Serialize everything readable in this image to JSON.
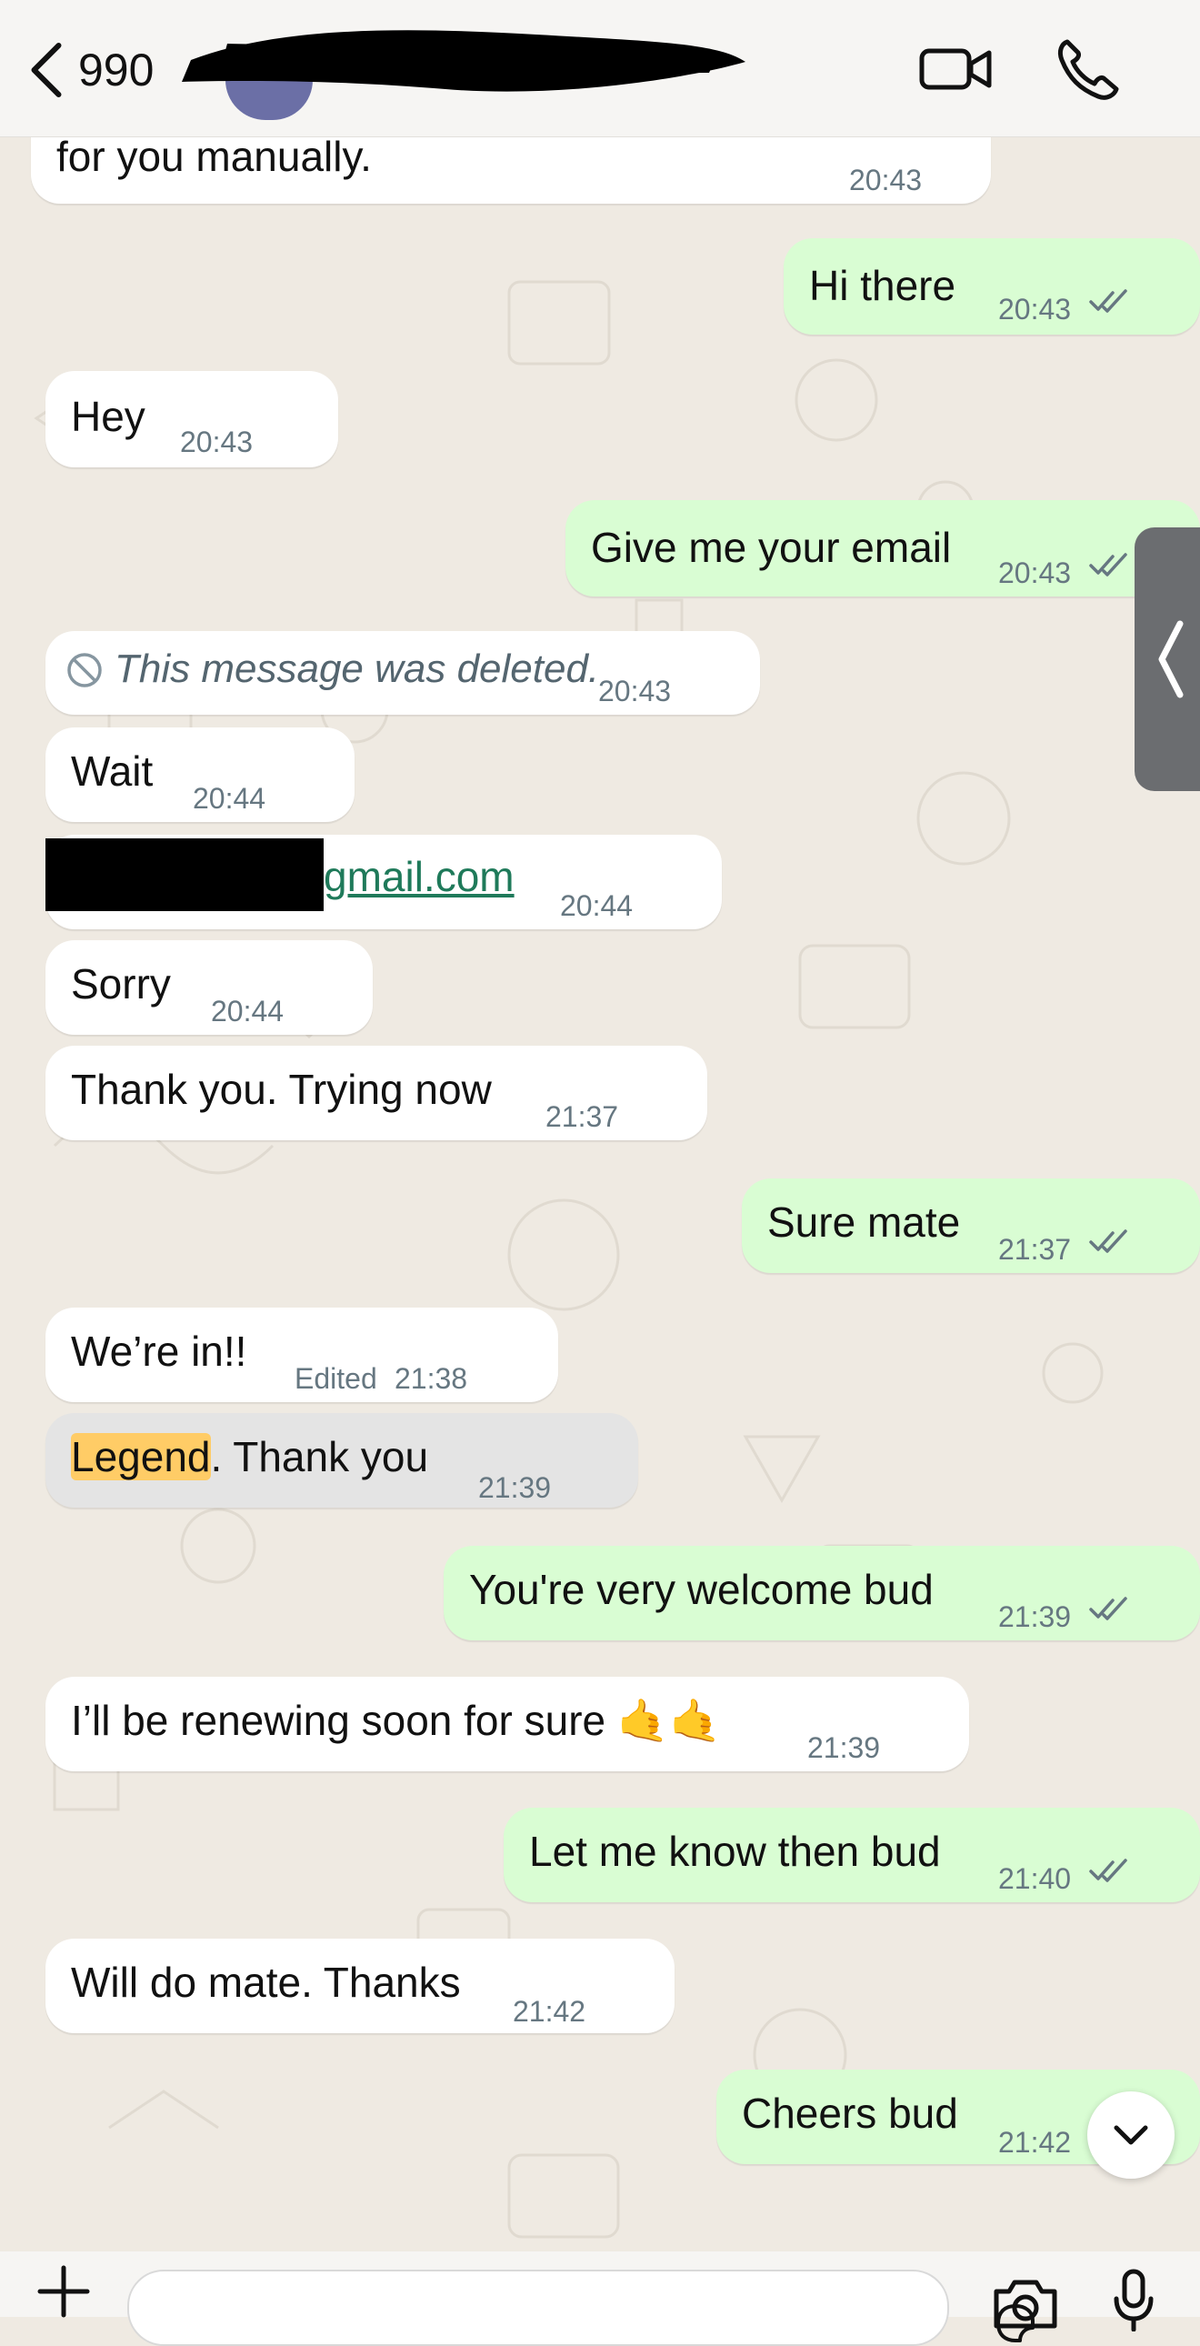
{
  "header": {
    "contact_name_visible": "990",
    "icons": {
      "back": "chevron-left-icon",
      "video": "video-camera-icon",
      "call": "phone-icon"
    }
  },
  "colors": {
    "chat_background": "#efeae2",
    "incoming_bubble": "#ffffff",
    "outgoing_bubble": "#d9fdd3",
    "timestamp": "#667781",
    "read_ticks": "#53bdeb",
    "link": "#1f7a5a",
    "highlight": "#ffcc66"
  },
  "messages": [
    {
      "direction": "in",
      "text": "for you manually.",
      "time": "20:43"
    },
    {
      "direction": "out",
      "text": "Hi there",
      "time": "20:43",
      "status": "read"
    },
    {
      "direction": "in",
      "text": "Hey",
      "time": "20:43"
    },
    {
      "direction": "out",
      "text": "Give me your email",
      "time": "20:43",
      "status": "read"
    },
    {
      "direction": "in",
      "text": "This message was deleted.",
      "time": "20:43",
      "deleted": true
    },
    {
      "direction": "in",
      "text": "Wait",
      "time": "20:44"
    },
    {
      "direction": "in",
      "text": "gmail.com",
      "time": "20:44",
      "link": true,
      "redacted_prefix": true
    },
    {
      "direction": "in",
      "text": "Sorry",
      "time": "20:44"
    },
    {
      "direction": "in",
      "text": "Thank you. Trying now",
      "time": "21:37"
    },
    {
      "direction": "out",
      "text": "Sure mate",
      "time": "21:37",
      "status": "read"
    },
    {
      "direction": "in",
      "text": "We’re in!!",
      "time": "21:38",
      "edited_label": "Edited"
    },
    {
      "direction": "in",
      "highlight": "Legend",
      "text": ". Thank you",
      "time": "21:39"
    },
    {
      "direction": "out",
      "text": "You're very welcome bud",
      "time": "21:39",
      "status": "read"
    },
    {
      "direction": "in",
      "text": "I’ll be renewing soon for sure 🤙🤙",
      "time": "21:39"
    },
    {
      "direction": "out",
      "text": "Let me know then bud",
      "time": "21:40",
      "status": "read"
    },
    {
      "direction": "in",
      "text": "Will do mate. Thanks",
      "time": "21:42"
    },
    {
      "direction": "out",
      "text": "Cheers bud",
      "time": "21:42",
      "status": "read"
    }
  ],
  "composer": {
    "icons": {
      "attach": "plus-icon",
      "sticker": "sticker-icon",
      "camera": "camera-icon",
      "mic": "microphone-icon"
    }
  }
}
